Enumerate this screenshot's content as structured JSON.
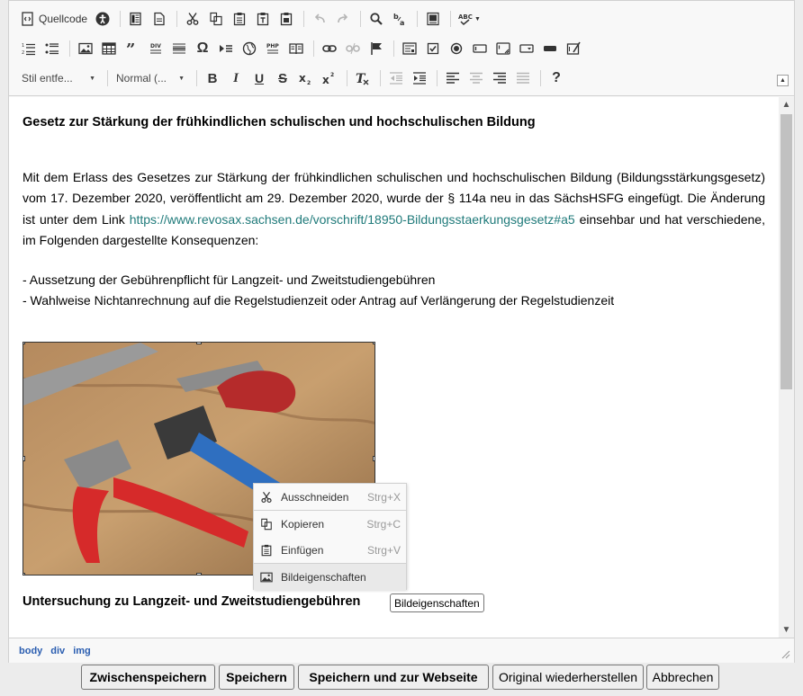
{
  "toolbar": {
    "source_label": "Quellcode",
    "styles_combo": "Stil entfe...",
    "format_combo": "Normal (..."
  },
  "document": {
    "heading1": "Gesetz zur Stärkung der frühkindlichen schulischen und hochschulischen Bildung",
    "para_before_link": "Mit dem Erlass des Gesetzes zur Stärkung der frühkindlichen schulischen und hochschulischen Bildung (Bildungsstärkungsgesetz) vom 17. Dezember 2020, veröffentlicht am 29. Dezember 2020, wurde der § 114a neu in das SächsHSFG eingefügt. Die Änderung ist unter dem Link ",
    "link_text": "https://www.revosax.sachsen.de/vorschrift/18950-Bildungsstaerkungsgesetz#a5",
    "para_after_link": " einsehbar und hat verschiedene, im Folgenden dargestellte Konsequenzen:",
    "list_items": [
      "- Aussetzung der Gebührenpflicht für Langzeit- und Zweitstudiengebühren",
      "- Wahlweise Nichtanrechnung auf die Regelstudienzeit oder Antrag auf Verlängerung der Regelstudienzeit"
    ],
    "heading2": "Untersuchung zu Langzeit- und Zweitstudiengebühren"
  },
  "path": [
    "body",
    "div",
    "img"
  ],
  "context_menu": [
    {
      "label": "Ausschneiden",
      "shortcut": "Strg+X",
      "icon": "scissors-icon"
    },
    {
      "label": "Kopieren",
      "shortcut": "Strg+C",
      "icon": "copy-icon"
    },
    {
      "label": "Einfügen",
      "shortcut": "Strg+V",
      "icon": "paste-icon"
    },
    {
      "label": "Bildeigenschaften",
      "shortcut": "",
      "icon": "image-icon"
    }
  ],
  "tooltip": "Bildeigenschaften",
  "footer": {
    "save_draft": "Zwischenspeichern",
    "save": "Speichern",
    "save_and_web": "Speichern und zur Webseite",
    "restore": "Original wiederherstellen",
    "cancel": "Abbrechen"
  }
}
